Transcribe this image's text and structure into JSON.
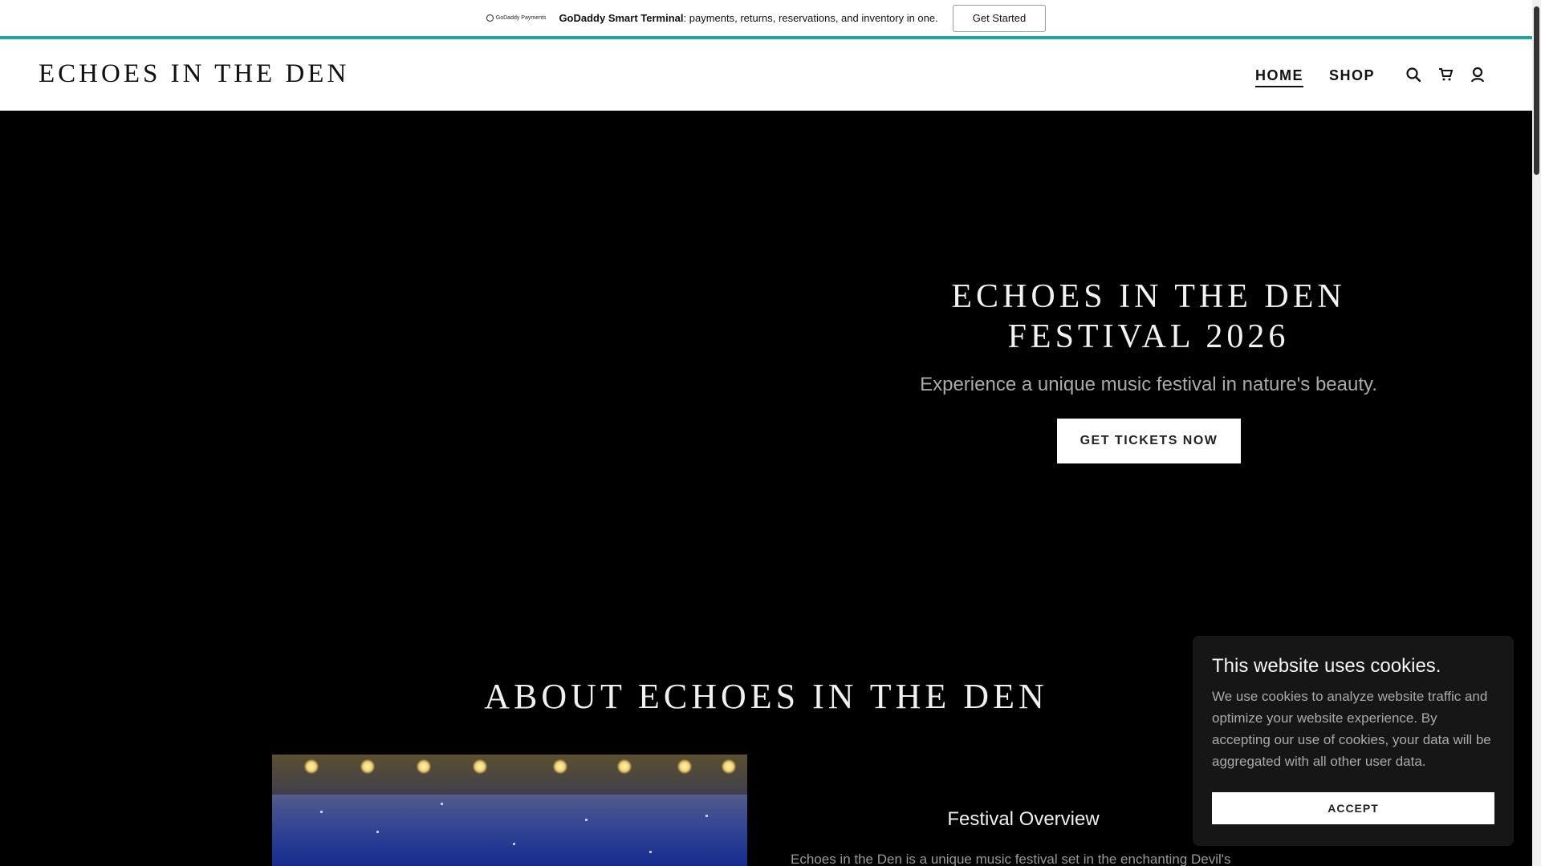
{
  "promo": {
    "logo_text": "GoDaddy Payments",
    "brand": "GoDaddy Smart Terminal",
    "text": ": payments, returns, reservations, and inventory in one.",
    "button": "Get Started",
    "accent_color": "#1ba6a6"
  },
  "header": {
    "logo": "ECHOES IN THE DEN",
    "nav": [
      {
        "label": "HOME",
        "active": true
      },
      {
        "label": "SHOP",
        "active": false
      }
    ],
    "icons": [
      "search-icon",
      "cart-icon",
      "account-icon"
    ]
  },
  "hero": {
    "title_line1": "ECHOES IN THE DEN",
    "title_line2": "FESTIVAL 2026",
    "subtitle": "Experience a unique music festival in nature's beauty.",
    "button": "GET TICKETS NOW"
  },
  "about": {
    "title": "ABOUT ECHOES IN THE DEN",
    "overview_title": "Festival Overview",
    "overview_text": "Echoes in the Den is a unique music festival set in the enchanting Devil's"
  },
  "cookie": {
    "title": "This website uses cookies.",
    "text": "We use cookies to analyze website traffic and optimize your website experience. By accepting our use of cookies, your data will be aggregated with all other user data.",
    "button": "ACCEPT"
  }
}
